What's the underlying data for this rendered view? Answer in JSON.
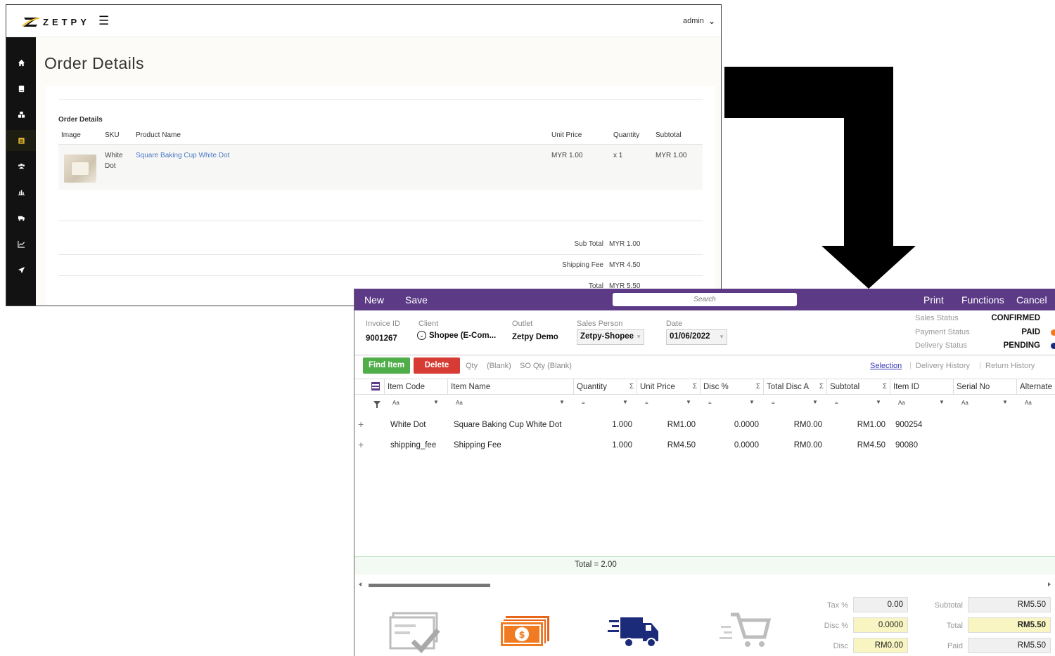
{
  "web": {
    "logo_text": "ZETPY",
    "user_menu": "admin",
    "page_title": "Order Details",
    "section_title": "Order Details",
    "columns": [
      "Image",
      "SKU",
      "Product Name",
      "Unit Price",
      "Quantity",
      "Subtotal"
    ],
    "item": {
      "sku_line1": "White",
      "sku_line2": "Dot",
      "product_name": "Square Baking Cup White Dot",
      "unit_price": "MYR 1.00",
      "quantity": "x 1",
      "subtotal": "MYR 1.00"
    },
    "summary": {
      "sub_total_label": "Sub Total",
      "sub_total_value": "MYR 1.00",
      "shipping_label": "Shipping Fee",
      "shipping_value": "MYR 4.50",
      "total_label": "Total",
      "total_value": "MYR 5.50"
    },
    "sidebar_icons": [
      "home-icon",
      "book-icon",
      "boxes-icon",
      "orders-icon",
      "users-icon",
      "bar-chart-icon",
      "truck-icon",
      "line-chart-icon",
      "send-icon"
    ]
  },
  "pos": {
    "bar": {
      "new": "New",
      "save": "Save",
      "search_placeholder": "Search",
      "print": "Print",
      "functions": "Functions",
      "cancel": "Cancel"
    },
    "info": {
      "invoice_id_label": "Invoice ID",
      "invoice_id": "9001267",
      "client_label": "Client",
      "client": "Shopee (E-Com...",
      "outlet_label": "Outlet",
      "outlet": "Zetpy Demo",
      "sales_person_label": "Sales Person",
      "sales_person": "Zetpy-Shopee",
      "date_label": "Date",
      "date": "01/06/2022"
    },
    "status": {
      "sales_label": "Sales Status",
      "sales": "CONFIRMED",
      "payment_label": "Payment Status",
      "payment": "PAID",
      "delivery_label": "Delivery Status",
      "delivery": "PENDING"
    },
    "toolbar": {
      "find_item": "Find Item",
      "delete": "Delete",
      "qty": "Qty",
      "qty_blank": "(Blank)",
      "so_qty": "SO Qty (Blank)",
      "tab_selection": "Selection",
      "tab_delivery": "Delivery History",
      "tab_return": "Return History"
    },
    "grid": {
      "columns": [
        "Item Code",
        "Item Name",
        "Quantity",
        "Unit Price",
        "Disc %",
        "Total Disc A",
        "Subtotal",
        "Item ID",
        "Serial No",
        "Alternate"
      ],
      "rows": [
        {
          "code": "White Dot",
          "name": "Square Baking Cup White Dot",
          "qty": "1.000",
          "price": "RM1.00",
          "disc": "0.0000",
          "total_disc": "RM0.00",
          "subtotal": "RM1.00",
          "item_id": "900254"
        },
        {
          "code": "shipping_fee",
          "name": "Shipping Fee",
          "qty": "1.000",
          "price": "RM4.50",
          "disc": "0.0000",
          "total_disc": "RM0.00",
          "subtotal": "RM4.50",
          "item_id": "90080"
        }
      ],
      "total": "Total = 2.00"
    },
    "totals": {
      "tax_label": "Tax %",
      "tax": "0.00",
      "disc_pct_label": "Disc %",
      "disc_pct": "0.0000",
      "disc_label": "Disc",
      "disc": "RM0.00",
      "subtotal_label": "Subtotal",
      "subtotal": "RM5.50",
      "total_label": "Total",
      "total": "RM5.50",
      "paid_label": "Paid",
      "paid": "RM5.50"
    },
    "colors": {
      "bar": "#5c3a86",
      "find_btn": "#4fad4a",
      "delete_btn": "#d63b34",
      "payment_dot": "#f07b22",
      "delivery_dot": "#1c2a7a"
    }
  }
}
